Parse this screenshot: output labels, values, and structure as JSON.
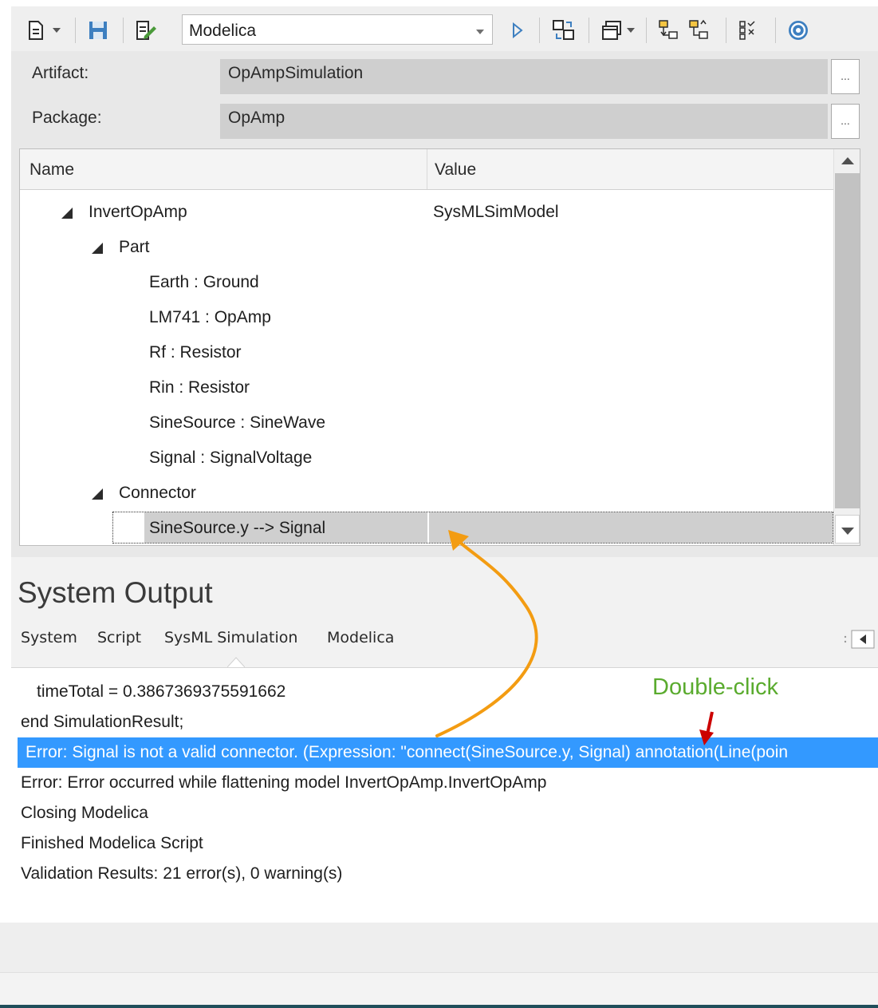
{
  "toolbar": {
    "language_value": "Modelica",
    "icons": [
      "new-document-icon",
      "dropdown-arrow-icon",
      "save-icon",
      "edit-check-icon",
      "run-icon",
      "generate-icon",
      "window-icon",
      "dropdown-arrow-icon",
      "tree-down-icon",
      "tree-up-icon",
      "validate-icon",
      "help-icon"
    ]
  },
  "artifact": {
    "label": "Artifact:",
    "value": "OpAmpSimulation",
    "browse": "..."
  },
  "package": {
    "label": "Package:",
    "value": "OpAmp",
    "browse": "..."
  },
  "grid": {
    "columns": {
      "name": "Name",
      "value": "Value"
    },
    "rows": [
      {
        "name": "InvertOpAmp",
        "value": "SysMLSimModel"
      },
      {
        "name": "Part",
        "value": ""
      },
      {
        "name": "Earth : Ground",
        "value": ""
      },
      {
        "name": "LM741 : OpAmp",
        "value": ""
      },
      {
        "name": "Rf : Resistor",
        "value": ""
      },
      {
        "name": "Rin : Resistor",
        "value": ""
      },
      {
        "name": "SineSource : SineWave",
        "value": ""
      },
      {
        "name": "Signal : SignalVoltage",
        "value": ""
      },
      {
        "name": "Connector",
        "value": ""
      },
      {
        "name": "SineSource.y --> Signal",
        "value": ""
      }
    ]
  },
  "output": {
    "title": "System Output",
    "tabs": [
      "System",
      "Script",
      "SysML Simulation",
      "Modelica"
    ],
    "active_tab": "SysML Simulation",
    "lines": [
      "timeTotal = 0.3867369375591662",
      "end SimulationResult;",
      "Error: Signal is not a valid connector. (Expression: \"connect(SineSource.y, Signal) annotation(Line(poin",
      "Error: Error occurred while flattening model InvertOpAmp.InvertOpAmp",
      "Closing Modelica",
      "Finished Modelica Script",
      "Validation Results: 21 error(s), 0 warning(s)"
    ],
    "selected_line_index": 2
  },
  "annotation": {
    "label": "Double-click",
    "label_color": "#5aab2e",
    "arrow_color": "#f39c12",
    "pointer_color": "#cc0000"
  },
  "colors": {
    "selection": "#3399ff",
    "value_field": "#cfcfcf",
    "panel": "#e8e8e8"
  }
}
